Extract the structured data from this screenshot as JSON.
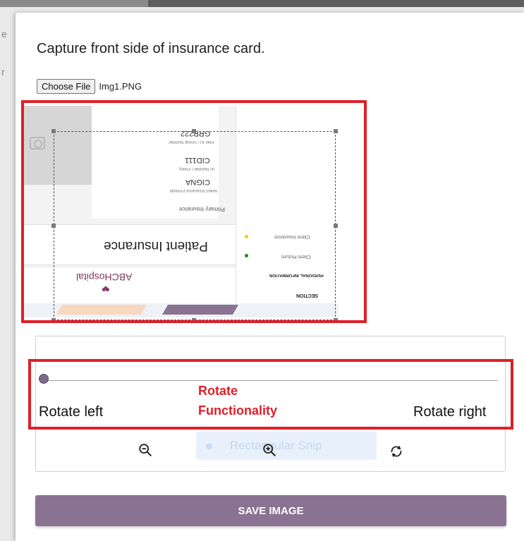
{
  "modal": {
    "title": "Capture front side of insurance card.",
    "choose_file_label": "Choose File",
    "file_name": "Img1.PNG"
  },
  "card_preview": {
    "group_number": "GRP222",
    "group_label": "Plan ID / Group Number",
    "id_number": "CID111",
    "id_label": "ID Number / Policy",
    "insurer": "CIGNA",
    "insurer_label": "Select Insurance Provider",
    "primary_label": "Primary Insurance",
    "patient_insurance": "Patient Insurance",
    "logo_text": "ABCHospital",
    "side_item_1": "Client Insurance",
    "side_item_2": "Client Picture",
    "side_item_3": "PERSONAL INFORMATION",
    "side_item_4": "SECTION"
  },
  "rotate": {
    "left_label": "Rotate left",
    "right_label": "Rotate right",
    "annotation": "Rotate Functionality",
    "value": 0
  },
  "snip": {
    "label": "Rectangular Snip"
  },
  "icons": {
    "zoom_out": "zoom-out-icon",
    "zoom_in": "zoom-in-icon",
    "reset": "rotate-reset-icon"
  },
  "background": {
    "left_letters": [
      "e",
      "r"
    ]
  },
  "save_button_label": "SAVE IMAGE",
  "colors": {
    "accent": "#8a7392",
    "highlight": "#e01f26"
  }
}
